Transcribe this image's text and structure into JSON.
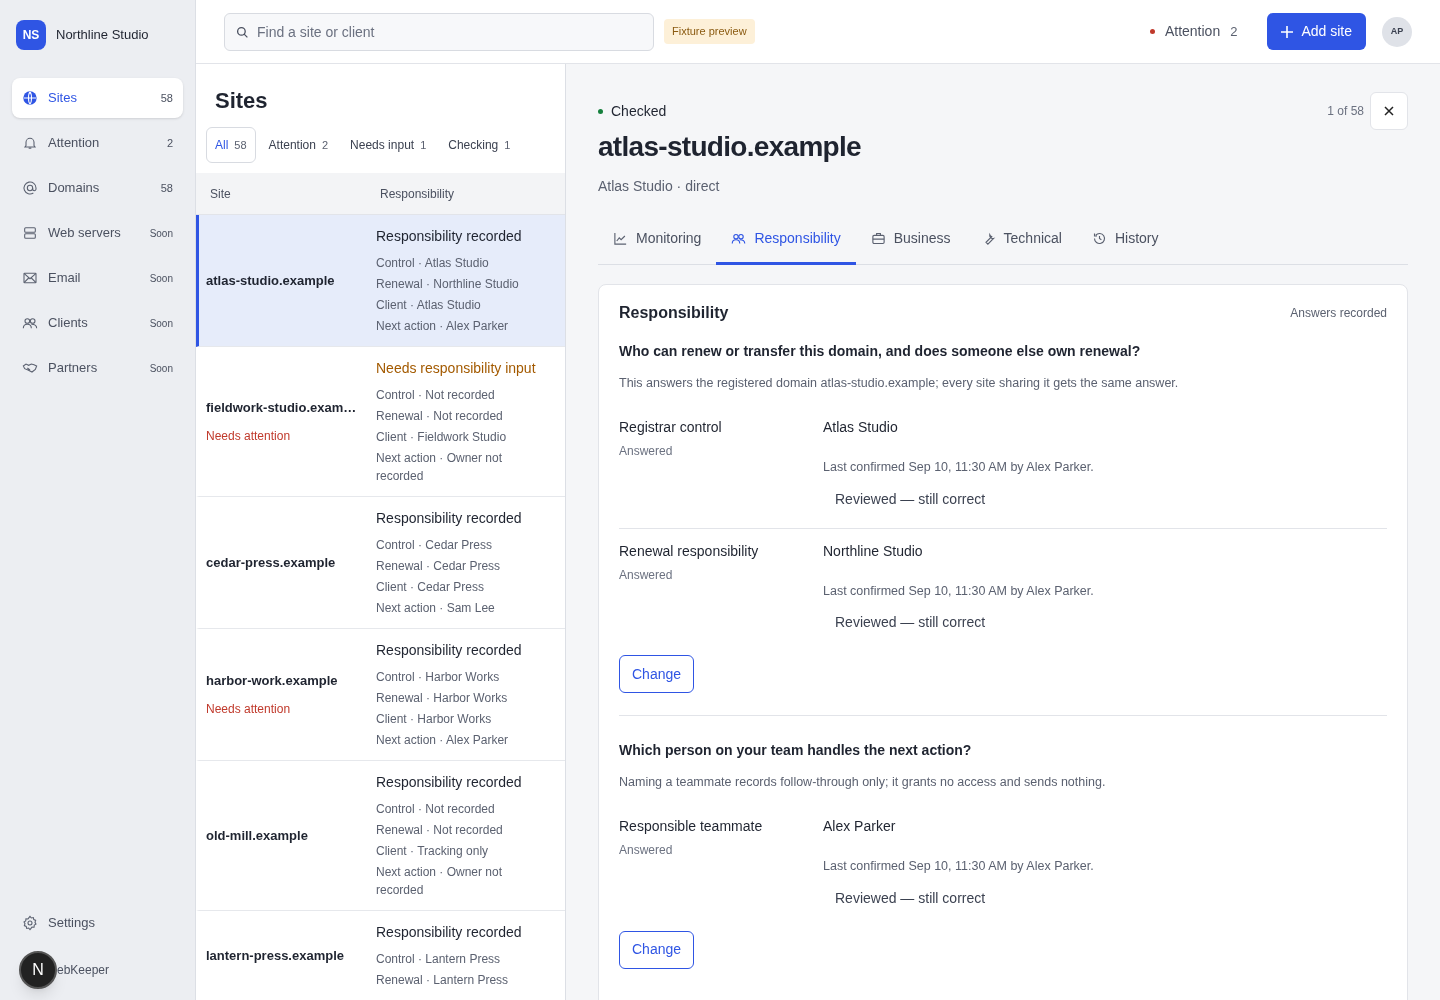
{
  "sidebar": {
    "brand": {
      "initials": "NS",
      "name": "Northline Studio"
    },
    "items": [
      {
        "label": "Sites",
        "badge": "58",
        "selected": true
      },
      {
        "label": "Attention",
        "badge": "2",
        "selected": false
      },
      {
        "label": "Domains",
        "badge": "58",
        "selected": false
      },
      {
        "label": "Web servers",
        "badge": "Soon",
        "selected": false
      },
      {
        "label": "Email",
        "badge": "Soon",
        "selected": false
      },
      {
        "label": "Clients",
        "badge": "Soon",
        "selected": false
      },
      {
        "label": "Partners",
        "badge": "Soon",
        "selected": false
      }
    ],
    "settings": "Settings",
    "app_badge": "N",
    "app_name": "ebKeeper"
  },
  "topbar": {
    "search": {
      "placeholder": "Find a site or client"
    },
    "preview_badge": "Fixture preview",
    "attention": {
      "label": "Attention",
      "count": "2"
    },
    "add_button": "Add site",
    "avatar": "AP"
  },
  "list": {
    "title": "Sites",
    "filters": [
      {
        "label": "All",
        "count": "58",
        "selected": true
      },
      {
        "label": "Attention",
        "count": "2",
        "selected": false
      },
      {
        "label": "Needs input",
        "count": "1",
        "selected": false
      },
      {
        "label": "Checking",
        "count": "1",
        "selected": false
      }
    ],
    "columns": [
      "Site",
      "Responsibility"
    ],
    "rows": [
      {
        "site": "atlas-studio.example",
        "selected": true,
        "status": "Responsibility recorded",
        "needs_input": false,
        "details": [
          "Control · Atlas Studio",
          "Renewal · Northline Studio",
          "Client · Atlas Studio",
          "Next action · Alex Parker"
        ]
      },
      {
        "site": "fieldwork-studio.exam…",
        "flag": "Needs attention",
        "selected": false,
        "status": "Needs responsibility input",
        "needs_input": true,
        "details": [
          "Control · Not recorded",
          "Renewal · Not recorded",
          "Client · Fieldwork Studio",
          "Next action · Owner not recorded"
        ]
      },
      {
        "site": "cedar-press.example",
        "selected": false,
        "status": "Responsibility recorded",
        "needs_input": false,
        "details": [
          "Control · Cedar Press",
          "Renewal · Cedar Press",
          "Client · Cedar Press",
          "Next action · Sam Lee"
        ]
      },
      {
        "site": "harbor-work.example",
        "flag": "Needs attention",
        "selected": false,
        "status": "Responsibility recorded",
        "needs_input": false,
        "details": [
          "Control · Harbor Works",
          "Renewal · Harbor Works",
          "Client · Harbor Works",
          "Next action · Alex Parker"
        ]
      },
      {
        "site": "old-mill.example",
        "selected": false,
        "status": "Responsibility recorded",
        "needs_input": false,
        "details": [
          "Control · Not recorded",
          "Renewal · Not recorded",
          "Client · Tracking only",
          "Next action · Owner not recorded"
        ]
      },
      {
        "site": "lantern-press.example",
        "selected": false,
        "status": "Responsibility recorded",
        "needs_input": false,
        "details": [
          "Control · Lantern Press",
          "Renewal · Lantern Press"
        ]
      }
    ]
  },
  "detail": {
    "status": {
      "label": "Checked",
      "color": "#15803d"
    },
    "position": "1 of 58",
    "title": "atlas-studio.example",
    "subtitle": "Atlas Studio · direct",
    "tabs": [
      {
        "label": "Monitoring",
        "selected": false
      },
      {
        "label": "Responsibility",
        "selected": true
      },
      {
        "label": "Business",
        "selected": false
      },
      {
        "label": "Technical",
        "selected": false
      },
      {
        "label": "History",
        "selected": false
      }
    ],
    "card": {
      "title": "Responsibility",
      "meta": "Answers recorded",
      "sections": [
        {
          "question": "Who can renew or transfer this domain, and does someone else own renewal?",
          "note": "This answers the registered domain atlas-studio.example; every site sharing it gets the same answer.",
          "fields": [
            {
              "label": "Registrar control",
              "state": "Answered",
              "value": "Atlas Studio",
              "confirmed": "Last confirmed Sep 10, 11:30 AM by Alex Parker.",
              "review": "Reviewed — still correct"
            },
            {
              "label": "Renewal responsibility",
              "state": "Answered",
              "value": "Northline Studio",
              "confirmed": "Last confirmed Sep 10, 11:30 AM by Alex Parker.",
              "review": "Reviewed — still correct"
            }
          ],
          "button": "Change"
        },
        {
          "question": "Which person on your team handles the next action?",
          "note": "Naming a teammate records follow-through only; it grants no access and sends nothing.",
          "fields": [
            {
              "label": "Responsible teammate",
              "state": "Answered",
              "value": "Alex Parker",
              "confirmed": "Last confirmed Sep 10, 11:30 AM by Alex Parker.",
              "review": "Reviewed — still correct"
            }
          ],
          "button": "Change"
        }
      ]
    }
  }
}
